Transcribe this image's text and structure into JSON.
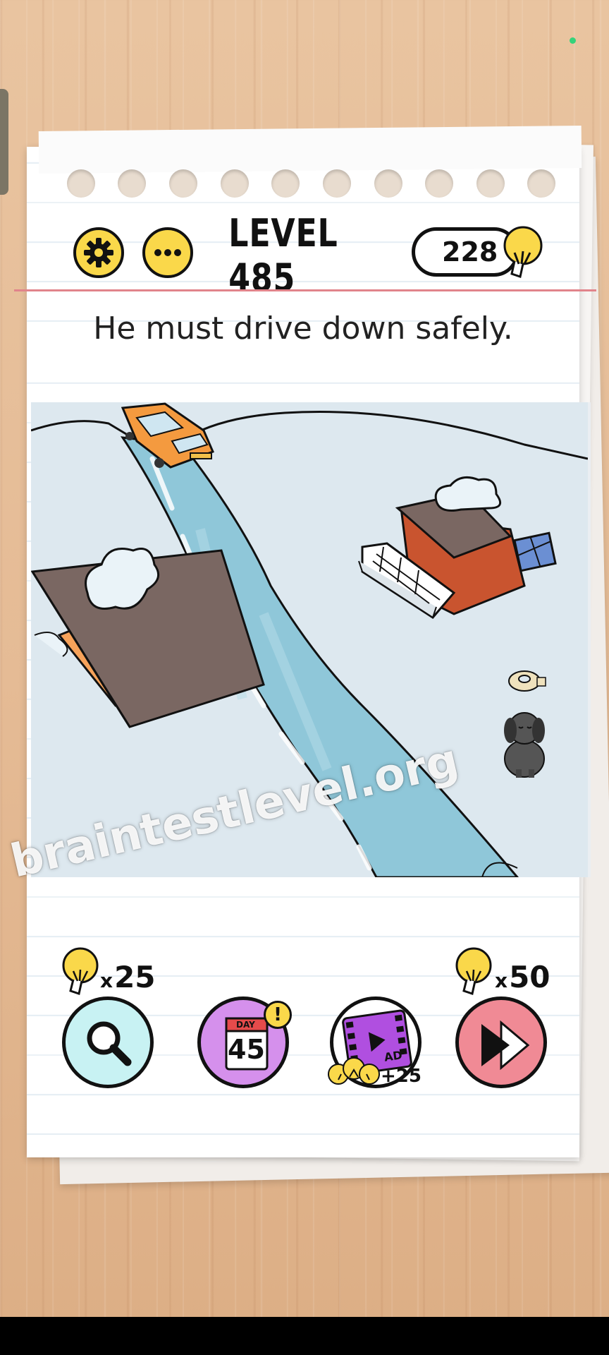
{
  "header": {
    "settings_icon": "gear-icon",
    "more_icon": "ellipsis-icon",
    "level_label": "LEVEL 485",
    "hint_count": "228",
    "hint_icon": "lightbulb-icon"
  },
  "question": "He must drive down safely.",
  "scene": {
    "objects": [
      "car",
      "road",
      "house-left",
      "house-right",
      "solar-panel",
      "tape-roll",
      "dog"
    ]
  },
  "watermark": "braintestlevel.org",
  "tools": {
    "hint_cost_prefix": "x",
    "hint_cost": "25",
    "skip_cost_prefix": "x",
    "skip_cost": "50",
    "daily_day_label": "DAY",
    "daily_day_number": "45",
    "daily_badge": "!",
    "ad_label": "AD",
    "ad_reward": "+25"
  },
  "colors": {
    "yellow": "#fad84a",
    "search_bg": "#c8f2f3",
    "daily_bg": "#d590ec",
    "ad_bg": "#b04fe0",
    "skip_bg": "#f08a95",
    "accent_red_line": "#e1848b",
    "car_orange": "#f49a3f",
    "road_blue": "#8fc7d9"
  }
}
